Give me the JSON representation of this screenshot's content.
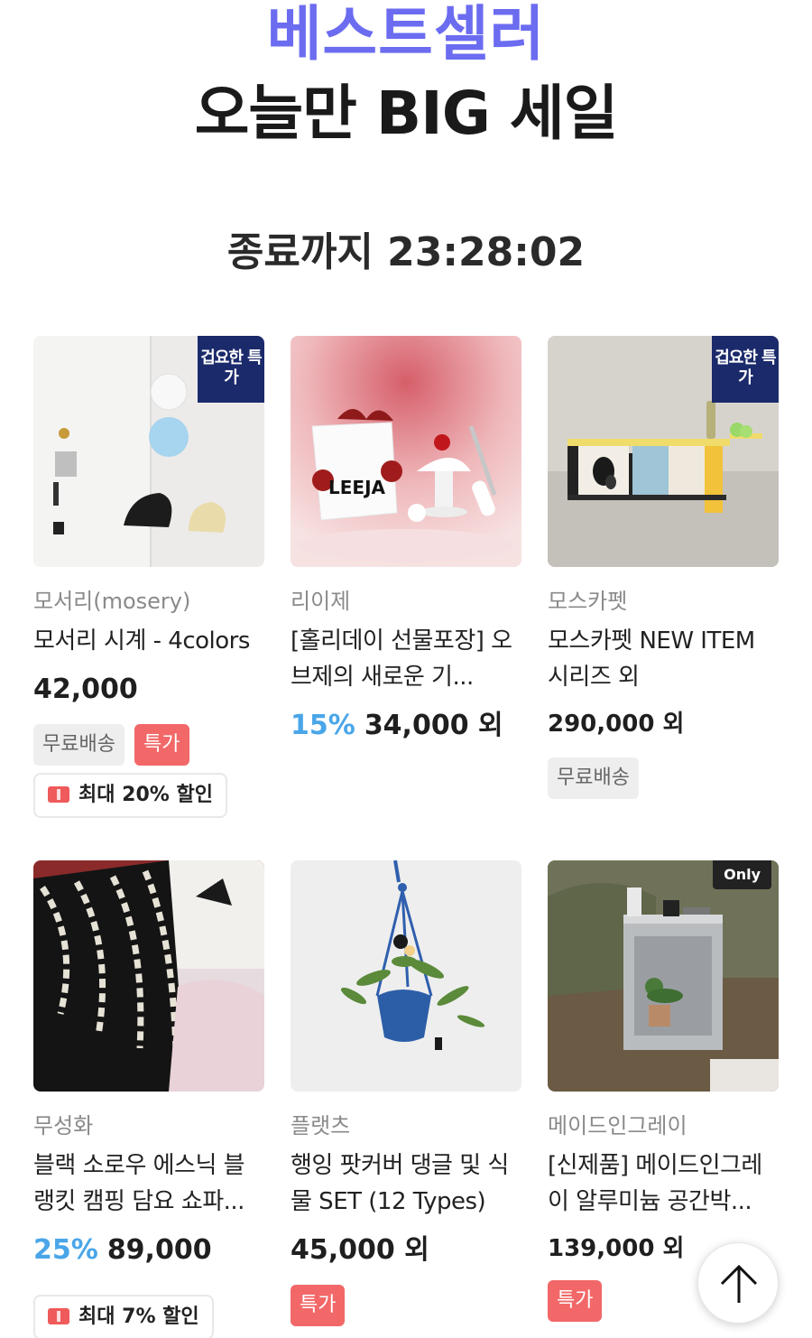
{
  "hero": {
    "title": "베스트셀러",
    "subtitle": "오늘만 BIG 세일",
    "countdown_label": "종료까지",
    "countdown_time": "23:28:02"
  },
  "colors": {
    "accent_title": "#6b6cf0",
    "discount": "#4aa6e8",
    "sale_tag": "#f26868",
    "special_badge": "#1b2a6b"
  },
  "products": [
    {
      "brand": "모서리(mosery)",
      "name": "모서리 시계 - 4colors",
      "discount": "",
      "price": "42,000",
      "badge": "겁요한 특가",
      "tags": [
        "무료배송",
        "특가"
      ],
      "coupon": "최대 20% 할인"
    },
    {
      "brand": "리이제",
      "name": "[홀리데이 선물포장] 오브제의 새로운 기...",
      "discount": "15%",
      "price": "34,000 외",
      "badge": "",
      "tags": [],
      "coupon": ""
    },
    {
      "brand": "모스카펫",
      "name": "모스카펫 NEW ITEM 시리즈 외",
      "discount": "",
      "price": "290,000 외",
      "badge": "겁요한 특가",
      "tags": [
        "무료배송"
      ],
      "coupon": ""
    },
    {
      "brand": "무성화",
      "name": "블랙 소로우 에스닉 블랭킷 캠핑 담요 쇼파...",
      "discount": "25%",
      "price": "89,000",
      "badge": "",
      "tags": [],
      "coupon": "최대 7% 할인"
    },
    {
      "brand": "플랫츠",
      "name": "행잉 팟커버 댕글 및 식물 SET (12 Types)",
      "discount": "",
      "price": "45,000 외",
      "badge": "",
      "tags": [
        "특가"
      ],
      "coupon": ""
    },
    {
      "brand": "메이드인그레이",
      "name": "[신제품] 메이드인그레이 알루미늄 공간박...",
      "discount": "",
      "price": "139,000 외",
      "badge": "Only",
      "tags": [
        "특가"
      ],
      "coupon": ""
    }
  ],
  "icons": {
    "coupon": "coupon-icon",
    "scroll_top": "arrow-up-icon"
  }
}
